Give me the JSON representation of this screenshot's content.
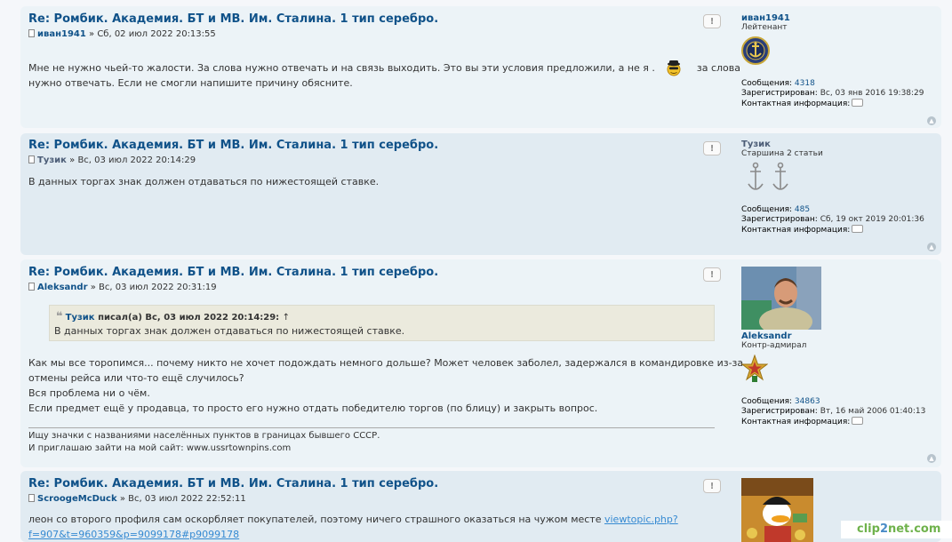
{
  "posts": [
    {
      "title": "Re: Ромбик. Академия. БТ и МВ. Им. Сталина. 1 тип серебро.",
      "author": "иван1941",
      "date": "» Сб, 02 июл 2022 20:13:55",
      "body": [
        "Мне не нужно чьей-то жалости. За слова нужно отвечать и на связь выходить. Это вы эти условия предложили, а не я .",
        "за слова",
        "нужно отвечать. Если не смогли напишите причину обясните."
      ],
      "report": "!",
      "profile": {
        "name": "иван1941",
        "rank": "Лейтенант",
        "posts_label": "Сообщения:",
        "posts_value": "4318",
        "reg_label": "Зарегистрирован:",
        "reg_value": "Вс, 03 янв 2016 19:38:29",
        "contact_label": "Контактная информация:"
      }
    },
    {
      "title": "Re: Ромбик. Академия. БТ и МВ. Им. Сталина. 1 тип серебро.",
      "author": "Тузик",
      "date": "» Вс, 03 июл 2022 20:14:29",
      "body": [
        "В данных торгах знак должен отдаваться по нижестоящей ставке."
      ],
      "report": "!",
      "profile": {
        "name": "Тузик",
        "rank": "Старшина 2 статьи",
        "posts_label": "Сообщения:",
        "posts_value": "485",
        "reg_label": "Зарегистрирован:",
        "reg_value": "Сб, 19 окт 2019 20:01:36",
        "contact_label": "Контактная информация:"
      }
    },
    {
      "title": "Re: Ромбик. Академия. БТ и МВ. Им. Сталина. 1 тип серебро.",
      "author": "Aleksandr",
      "date": "» Вс, 03 июл 2022 20:31:19",
      "quote": {
        "author": "Тузик",
        "cite_rest": "писал(а) Вс, 03 июл 2022 20:14:29:",
        "arrow": "↑",
        "text": "В данных торгах знак должен отдаваться по нижестоящей ставке."
      },
      "body": [
        "Как мы все торопимся... почему никто не хочет подождать немного дольше? Может человек заболел, задержался в командировке из-за",
        "отмены рейса или что-то ещё случилось?",
        "Вся проблема ни о чём.",
        "Если предмет ещё у продавца, то просто его нужно отдать победителю торгов (по блицу) и закрыть вопрос."
      ],
      "signature": [
        "Ищу значки с названиями населённых пунктов в границах бывшего СССР.",
        "И приглашаю зайти на мой сайт: www.ussrtownpins.com"
      ],
      "report": "!",
      "profile": {
        "name": "Aleksandr",
        "rank": "Контр-адмирал",
        "posts_label": "Сообщения:",
        "posts_value": "34863",
        "reg_label": "Зарегистрирован:",
        "reg_value": "Вт, 16 май 2006 01:40:13",
        "contact_label": "Контактная информация:"
      }
    },
    {
      "title": "Re: Ромбик. Академия. БТ и МВ. Им. Сталина. 1 тип серебро.",
      "author": "ScroogeMcDuck",
      "date": "» Вс, 03 июл 2022 22:52:11",
      "body_before_link": "леон со второго профиля сам оскорбляет покупателей, поэтому ничего страшного оказаться на чужом месте",
      "link_line1": "viewtopic.php?",
      "link_line2": "f=907&t=960359&p=9099178#p9099178",
      "report": "!"
    }
  ],
  "watermark": {
    "part1": "clip",
    "part2": "2",
    "part3": "net.com"
  },
  "colors": {
    "bg1": "#e1ebf2",
    "bg2": "#ecf3f7",
    "title": "#105289",
    "link": "#368ad2"
  }
}
